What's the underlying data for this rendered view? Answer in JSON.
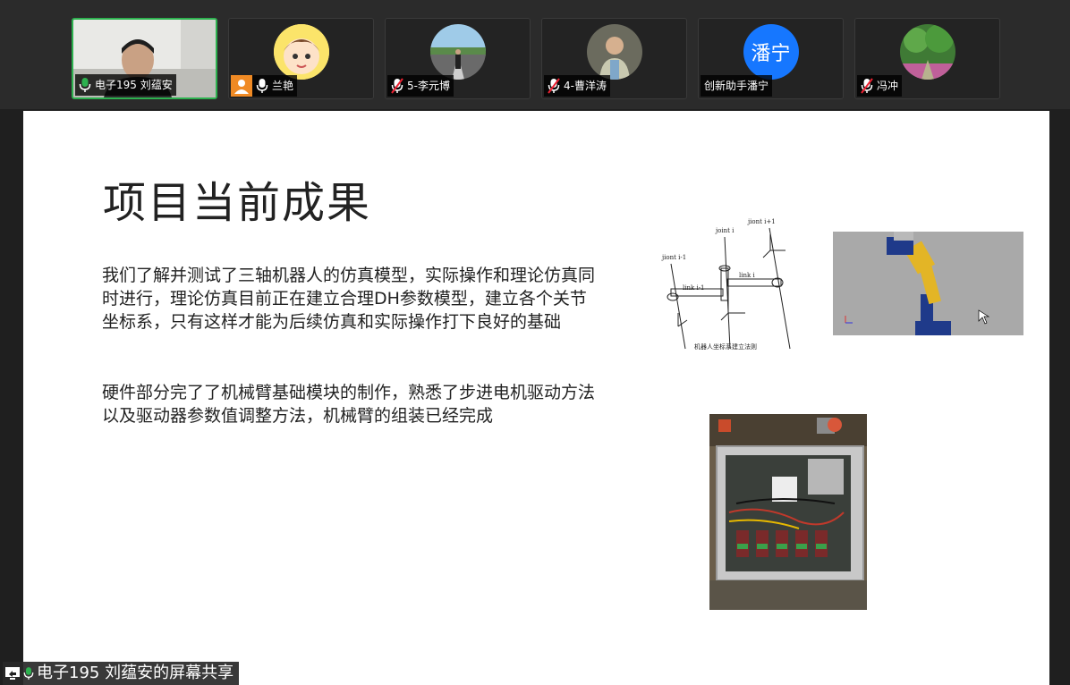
{
  "participants": [
    {
      "name": "电子195 刘蕴安",
      "mic": "on",
      "active": true
    },
    {
      "name": "兰艳",
      "mic": "on",
      "host": true
    },
    {
      "name": "5-李元博",
      "mic": "muted"
    },
    {
      "name": "4-曹洋涛",
      "mic": "muted"
    },
    {
      "name": "创新助手潘宁",
      "mic": "none",
      "avatar_text": "潘宁",
      "avatar_color": "#1677ff"
    },
    {
      "name": "冯冲",
      "mic": "muted"
    }
  ],
  "slide": {
    "title": "项目当前成果",
    "paragraphs": [
      "我们了解并测试了三轴机器人的仿真模型，实际操作和理论仿真同时进行，理论仿真目前正在建立合理DH参数模型，建立各个关节坐标系，只有这样才能为后续仿真和实际操作打下良好的基础",
      "硬件部分完了了机械臂基础模块的制作，熟悉了步进电机驱动方法以及驱动器参数值调整方法，机械臂的组装已经完成"
    ],
    "diagram": {
      "caption": "机器人坐标系建立法则",
      "labels": {
        "joint_prev": "jiont i-1",
        "joint_i": "joint i",
        "joint_next": "jiont i+1",
        "link_prev": "link i-1",
        "link_i": "link i"
      }
    }
  },
  "share_label": "电子195 刘蕴安的屏幕共享",
  "colors": {
    "active_border": "#2db14f",
    "mic_on": "#2db14f",
    "mic_muted": "#ffffff",
    "host_badge": "#f08a24"
  }
}
